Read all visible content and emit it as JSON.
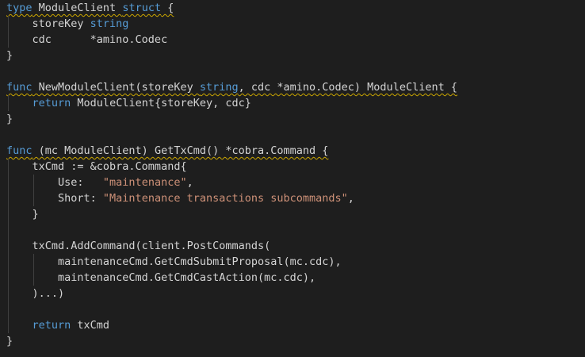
{
  "colors": {
    "background": "#1e1e1e",
    "keyword": "#569cd6",
    "function": "#dcdcaa",
    "string": "#ce9178",
    "text": "#d4d4d4",
    "warning_squiggle": "#cca700",
    "indent_guide": "#404040"
  },
  "lines": [
    {
      "indent": 0,
      "squiggle": true,
      "tokens": [
        {
          "t": "type",
          "k": "kw"
        },
        {
          "t": " ModuleClient ",
          "k": "plain"
        },
        {
          "t": "struct",
          "k": "kw"
        },
        {
          "t": " {",
          "k": "plain"
        }
      ]
    },
    {
      "indent": 1,
      "squiggle": false,
      "tokens": [
        {
          "t": "    storeKey ",
          "k": "plain"
        },
        {
          "t": "string",
          "k": "kw"
        }
      ]
    },
    {
      "indent": 1,
      "squiggle": false,
      "tokens": [
        {
          "t": "    cdc      *amino.Codec",
          "k": "plain"
        }
      ]
    },
    {
      "indent": 0,
      "squiggle": false,
      "tokens": [
        {
          "t": "}",
          "k": "plain"
        }
      ]
    },
    {
      "indent": 0,
      "squiggle": false,
      "tokens": []
    },
    {
      "indent": 0,
      "squiggle": true,
      "tokens": [
        {
          "t": "func",
          "k": "kw"
        },
        {
          "t": " NewModuleClient(storeKey ",
          "k": "plain"
        },
        {
          "t": "string",
          "k": "kw"
        },
        {
          "t": ", cdc *amino.Codec) ModuleClient {",
          "k": "plain"
        }
      ]
    },
    {
      "indent": 1,
      "squiggle": false,
      "tokens": [
        {
          "t": "    ",
          "k": "plain"
        },
        {
          "t": "return",
          "k": "kw"
        },
        {
          "t": " ModuleClient{storeKey, cdc}",
          "k": "plain"
        }
      ]
    },
    {
      "indent": 0,
      "squiggle": false,
      "tokens": [
        {
          "t": "}",
          "k": "plain"
        }
      ]
    },
    {
      "indent": 0,
      "squiggle": false,
      "tokens": []
    },
    {
      "indent": 0,
      "squiggle": true,
      "tokens": [
        {
          "t": "func",
          "k": "kw"
        },
        {
          "t": " (mc ModuleClient) GetTxCmd() *cobra.Command {",
          "k": "plain"
        }
      ]
    },
    {
      "indent": 1,
      "squiggle": false,
      "tokens": [
        {
          "t": "    txCmd := &cobra.Command{",
          "k": "plain"
        }
      ]
    },
    {
      "indent": 2,
      "squiggle": false,
      "tokens": [
        {
          "t": "        Use:   ",
          "k": "plain"
        },
        {
          "t": "\"maintenance\"",
          "k": "str"
        },
        {
          "t": ",",
          "k": "plain"
        }
      ]
    },
    {
      "indent": 2,
      "squiggle": false,
      "tokens": [
        {
          "t": "        Short: ",
          "k": "plain"
        },
        {
          "t": "\"Maintenance transactions subcommands\"",
          "k": "str"
        },
        {
          "t": ",",
          "k": "plain"
        }
      ]
    },
    {
      "indent": 1,
      "squiggle": false,
      "tokens": [
        {
          "t": "    }",
          "k": "plain"
        }
      ]
    },
    {
      "indent": 1,
      "squiggle": false,
      "tokens": []
    },
    {
      "indent": 1,
      "squiggle": false,
      "tokens": [
        {
          "t": "    txCmd.AddCommand(client.PostCommands(",
          "k": "plain"
        }
      ]
    },
    {
      "indent": 2,
      "squiggle": false,
      "tokens": [
        {
          "t": "        maintenanceCmd.GetCmdSubmitProposal(mc.cdc),",
          "k": "plain"
        }
      ]
    },
    {
      "indent": 2,
      "squiggle": false,
      "tokens": [
        {
          "t": "        maintenanceCmd.GetCmdCastAction(mc.cdc),",
          "k": "plain"
        }
      ]
    },
    {
      "indent": 1,
      "squiggle": false,
      "tokens": [
        {
          "t": "    )...)",
          "k": "plain"
        }
      ]
    },
    {
      "indent": 1,
      "squiggle": false,
      "tokens": []
    },
    {
      "indent": 1,
      "squiggle": false,
      "tokens": [
        {
          "t": "    ",
          "k": "plain"
        },
        {
          "t": "return",
          "k": "kw"
        },
        {
          "t": " txCmd",
          "k": "plain"
        }
      ]
    },
    {
      "indent": 0,
      "squiggle": false,
      "tokens": [
        {
          "t": "}",
          "k": "plain"
        }
      ]
    }
  ]
}
